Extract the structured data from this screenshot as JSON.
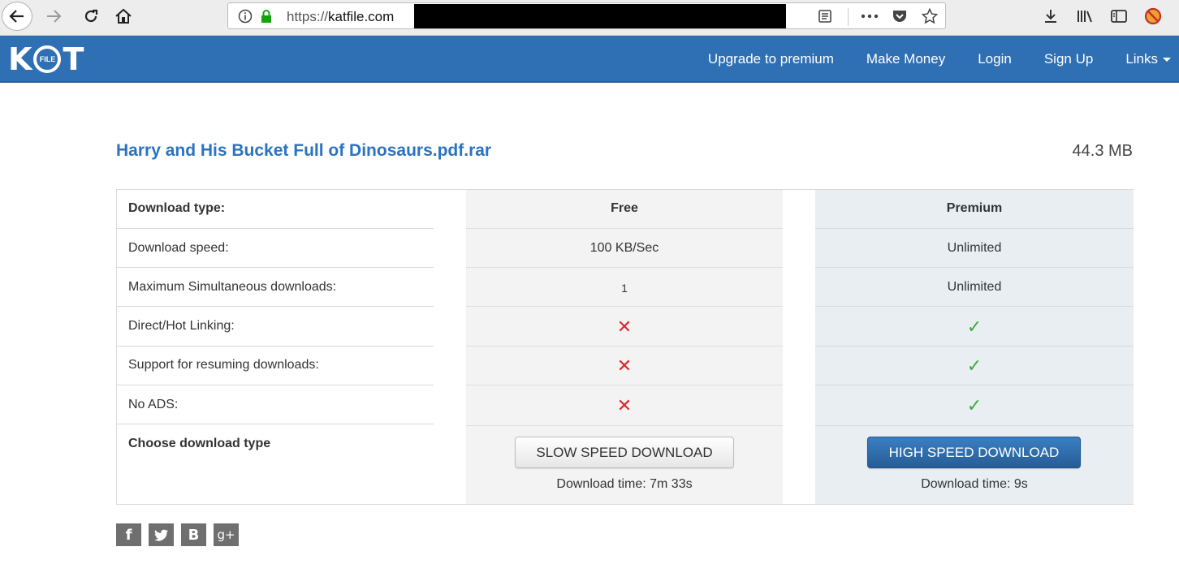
{
  "browser": {
    "url_scheme": "https://",
    "url_host": "katfile.com",
    "icons": [
      "back-arrow-icon",
      "forward-arrow-icon",
      "reload-icon",
      "home-icon",
      "info-icon",
      "lock-icon",
      "reader-view-icon",
      "more-icon",
      "pocket-icon",
      "bookmark-star-icon",
      "download-icon",
      "library-icon",
      "sidebar-icon",
      "adblock-icon"
    ]
  },
  "site_nav": {
    "logo": {
      "left": "K",
      "middle": "FILE",
      "right": "T"
    },
    "links": [
      "Upgrade to premium",
      "Make Money",
      "Login",
      "Sign Up",
      "Links"
    ]
  },
  "file": {
    "name": "Harry and His Bucket Full of Dinosaurs.pdf.rar",
    "size": "44.3 MB"
  },
  "table": {
    "header": {
      "label": "Download type:",
      "free": "Free",
      "premium": "Premium"
    },
    "rows": [
      {
        "label": "Download speed:",
        "free": "100 KB/Sec",
        "premium": "Unlimited"
      },
      {
        "label": "Maximum Simultaneous downloads:",
        "free": "1",
        "premium": "Unlimited"
      },
      {
        "label": "Direct/Hot Linking:",
        "free": "no",
        "premium": "yes"
      },
      {
        "label": "Support for resuming downloads:",
        "free": "no",
        "premium": "yes"
      },
      {
        "label": "No ADS:",
        "free": "no",
        "premium": "yes"
      }
    ],
    "choose_label": "Choose download type",
    "slow_button": "SLOW SPEED DOWNLOAD",
    "fast_button": "HIGH SPEED DOWNLOAD",
    "free_time": "Download time: 7m 33s",
    "premium_time": "Download time: 9s"
  },
  "share": {
    "facebook": "f",
    "twitter": "t",
    "blogger": "B",
    "googleplus": "g+"
  },
  "colors": {
    "nav_bg": "#2f6fb3",
    "title": "#2a73c1",
    "cross": "#d9262e",
    "check": "#3fa83c",
    "fast_button": "#2f6fab"
  }
}
